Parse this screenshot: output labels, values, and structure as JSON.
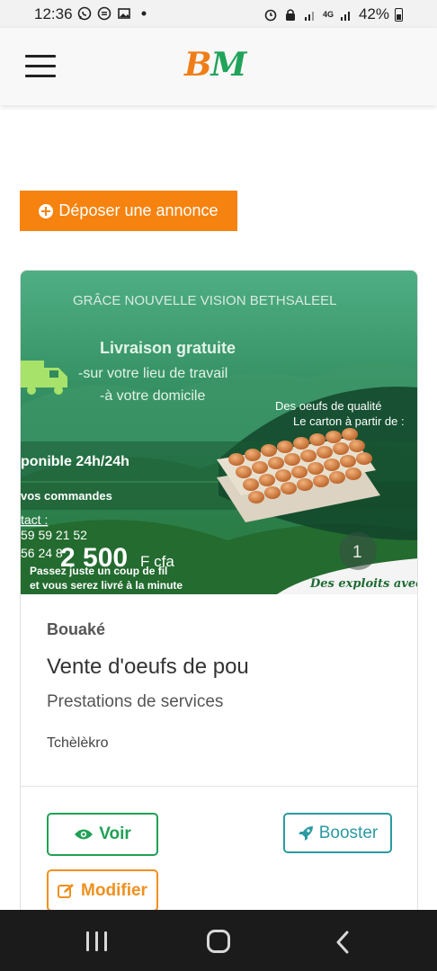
{
  "status_bar": {
    "time": "12:36",
    "battery": "42%",
    "network": "4G",
    "icons": [
      "whatsapp-icon",
      "message-icon",
      "gallery-icon",
      "dot-icon",
      "alarm-icon",
      "lock-icon",
      "signal-icon",
      "battery-icon"
    ]
  },
  "header": {
    "logo_b": "B",
    "logo_m": "M",
    "menu_icon": "hamburger-icon",
    "colors": {
      "logo_b": "#f07e18",
      "logo_m": "#20a35a"
    }
  },
  "deposit_button": {
    "label": "Déposer une annonce",
    "icon": "plus-circle-icon",
    "color": "#f6830f"
  },
  "listing": {
    "image": {
      "org_name": "GRÂCE NOUVELLE VISION BETHSALEEL",
      "delivery_title": "Livraison gratuite",
      "delivery_line1": "-sur votre lieu de travail",
      "delivery_line2": "-à votre domicile",
      "quality_line1": "Des oeufs de qualité",
      "quality_line2": "Le carton à partir de :",
      "availability": "ponible 24h/24h",
      "orders": "vos commandes",
      "contact": "tact :",
      "phone1": "59 59 21 52",
      "phone2": "56 24 8",
      "price": "2 500",
      "currency": "F cfa",
      "tagline1": "Passez juste un coup de fil",
      "tagline2": "et vous serez livré à la minute",
      "slogan": "Des exploits avec !",
      "image_counter": "1"
    },
    "city": "Bouaké",
    "title": "Vente d'oeufs de pou",
    "category": "Prestations de services",
    "locality": "Tchèlèkro",
    "buttons": {
      "view": "Voir",
      "boost": "Booster",
      "edit": "Modifier"
    },
    "colors": {
      "view": "#21a055",
      "boost": "#2b9aa2",
      "edit": "#f0901e"
    }
  },
  "nav_bar": {
    "icons": [
      "recents-icon",
      "home-icon",
      "back-icon"
    ]
  }
}
